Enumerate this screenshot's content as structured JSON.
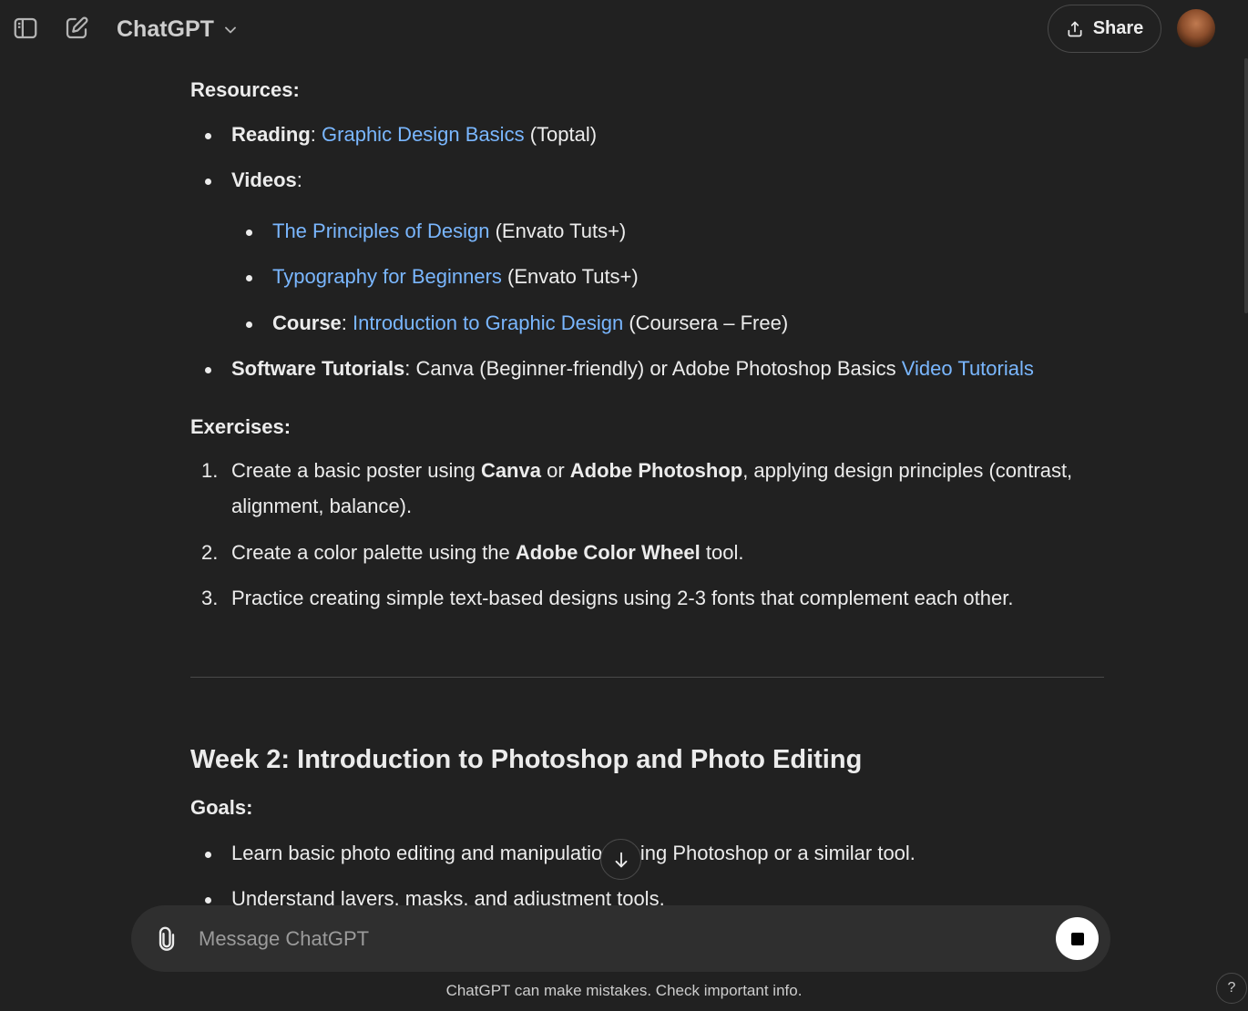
{
  "header": {
    "model_name": "ChatGPT",
    "share_label": "Share"
  },
  "content": {
    "resources_heading": "Resources:",
    "resources": [
      {
        "label": "Reading",
        "link": "Graphic Design Basics",
        "suffix": " (Toptal)"
      },
      {
        "label": "Videos"
      }
    ],
    "videos": [
      {
        "link": "The Principles of Design",
        "suffix": " (Envato Tuts+)"
      },
      {
        "link": "Typography for Beginners",
        "suffix": " (Envato Tuts+)"
      },
      {
        "label": "Course",
        "link": "Introduction to Graphic Design",
        "suffix": " (Coursera – Free)"
      }
    ],
    "software": {
      "label": "Software Tutorials",
      "text": " Canva (Beginner-friendly) or Adobe Photoshop Basics ",
      "link": "Video Tutorials"
    },
    "exercises_heading": "Exercises:",
    "exercises": [
      {
        "num": "1.",
        "a": "Create a basic poster using ",
        "b1": "Canva",
        "c": " or ",
        "b2": "Adobe Photoshop",
        "d": ", applying design principles (contrast, alignment, balance)."
      },
      {
        "num": "2.",
        "a": "Create a color palette using the ",
        "b1": "Adobe Color Wheel",
        "c": " tool."
      },
      {
        "num": "3.",
        "a": "Practice creating simple text-based designs using 2-3 fonts that complement each other."
      }
    ],
    "week_title": "Week 2: Introduction to Photoshop and Photo Editing",
    "goals_heading": "Goals:",
    "goals": [
      "Learn basic photo editing and manipulation using Photoshop or a similar tool.",
      "Understand layers, masks, and adjustment tools."
    ]
  },
  "composer": {
    "placeholder": "Message ChatGPT"
  },
  "footer": {
    "disclaimer": "ChatGPT can make mistakes. Check important info.",
    "help_label": "?"
  }
}
